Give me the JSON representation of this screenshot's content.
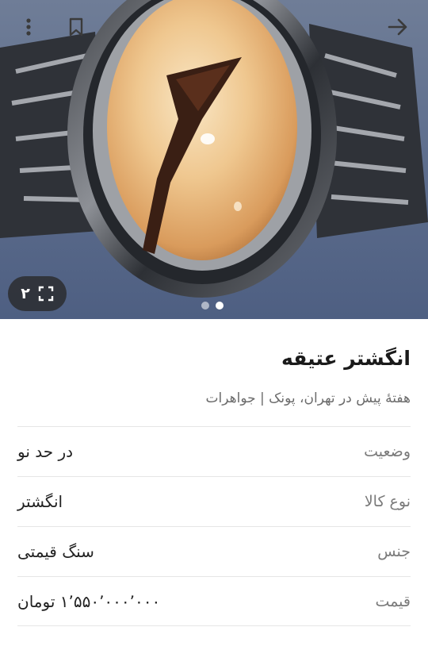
{
  "gallery": {
    "image_count": "۲",
    "page_dots": 2,
    "active_dot": 1,
    "icons": {
      "more": "vertical-dots-icon",
      "bookmark": "bookmark-icon",
      "back": "arrow-right-icon",
      "fullscreen": "fullscreen-icon"
    }
  },
  "listing": {
    "title": "انگشتر عتیقه",
    "subtitle": "هفتهٔ پیش در تهران، پونک | جواهرات"
  },
  "details": [
    {
      "label": "وضعیت",
      "value": "در حد نو"
    },
    {
      "label": "نوع کالا",
      "value": "انگشتر"
    },
    {
      "label": "جنس",
      "value": "سنگ قیمتی"
    },
    {
      "label": "قیمت",
      "value": "۱٬۵۵۰٬۰۰۰٬۰۰۰ تومان"
    }
  ]
}
